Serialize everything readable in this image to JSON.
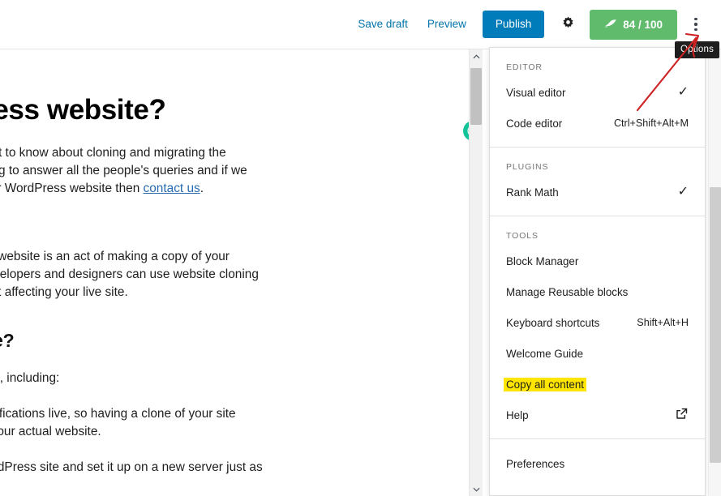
{
  "toolbar": {
    "save_draft_label": "Save draft",
    "preview_label": "Preview",
    "publish_label": "Publish",
    "settings_icon": "gear-icon",
    "seo_score": {
      "icon": "rank-math-icon",
      "value": "84 / 100"
    },
    "options_icon": "kebab-menu-icon"
  },
  "tooltip": {
    "text": "Options"
  },
  "document": {
    "heading_main": "WordPress website?",
    "paragraph_1_line_1": "ss website. Or want to know about cloning and migrating the",
    "paragraph_1_line_2": "we prepare this blog to answer all the people's queries and if we",
    "paragraph_1_line_3_pre": "arding Cloning your WordPress website then ",
    "paragraph_1_link": "contact us",
    "paragraph_1_line_3_post": ".",
    "paragraph_2_line_1": "ne thing. A cloning website is an act of making a copy of your",
    "paragraph_2_line_2": "uct a new one. Developers and designers can use website cloning",
    "paragraph_2_line_3": "provements without affecting your live site.",
    "heading_sub": "ress website?",
    "paragraph_3": "variety of situations, including:",
    "paragraph_4_line_1": "est enormous modifications live, so having a clone of your site",
    "paragraph_4_line_2": "before upgrading your actual website.",
    "paragraph_5": "may take your WordPress site and set it up on a new server just as",
    "grammarly_icon": "grammarly-icon"
  },
  "menu": {
    "groups": [
      {
        "label": "EDITOR",
        "items": [
          {
            "label": "Visual editor",
            "shortcut": "",
            "checked": true,
            "highlighted": false,
            "external": false
          },
          {
            "label": "Code editor",
            "shortcut": "Ctrl+Shift+Alt+M",
            "checked": false,
            "highlighted": false,
            "external": false
          }
        ]
      },
      {
        "label": "PLUGINS",
        "items": [
          {
            "label": "Rank Math",
            "shortcut": "",
            "checked": true,
            "highlighted": false,
            "external": false
          }
        ]
      },
      {
        "label": "TOOLS",
        "items": [
          {
            "label": "Block Manager",
            "shortcut": "",
            "checked": false,
            "highlighted": false,
            "external": false
          },
          {
            "label": "Manage Reusable blocks",
            "shortcut": "",
            "checked": false,
            "highlighted": false,
            "external": false
          },
          {
            "label": "Keyboard shortcuts",
            "shortcut": "Shift+Alt+H",
            "checked": false,
            "highlighted": false,
            "external": false
          },
          {
            "label": "Welcome Guide",
            "shortcut": "",
            "checked": false,
            "highlighted": false,
            "external": false
          },
          {
            "label": "Copy all content",
            "shortcut": "",
            "checked": false,
            "highlighted": true,
            "external": false
          },
          {
            "label": "Help",
            "shortcut": "",
            "checked": false,
            "highlighted": false,
            "external": true
          }
        ]
      },
      {
        "label": "",
        "items": [
          {
            "label": "Preferences",
            "shortcut": "",
            "checked": false,
            "highlighted": false,
            "external": false
          }
        ]
      }
    ]
  },
  "colors": {
    "publish_blue": "#007cba",
    "link_blue": "#0073aa",
    "seo_green": "#61bb6d",
    "highlight_yellow": "#ffe600",
    "annotation_red": "#cc2222",
    "grammarly_green": "#15c39a"
  }
}
